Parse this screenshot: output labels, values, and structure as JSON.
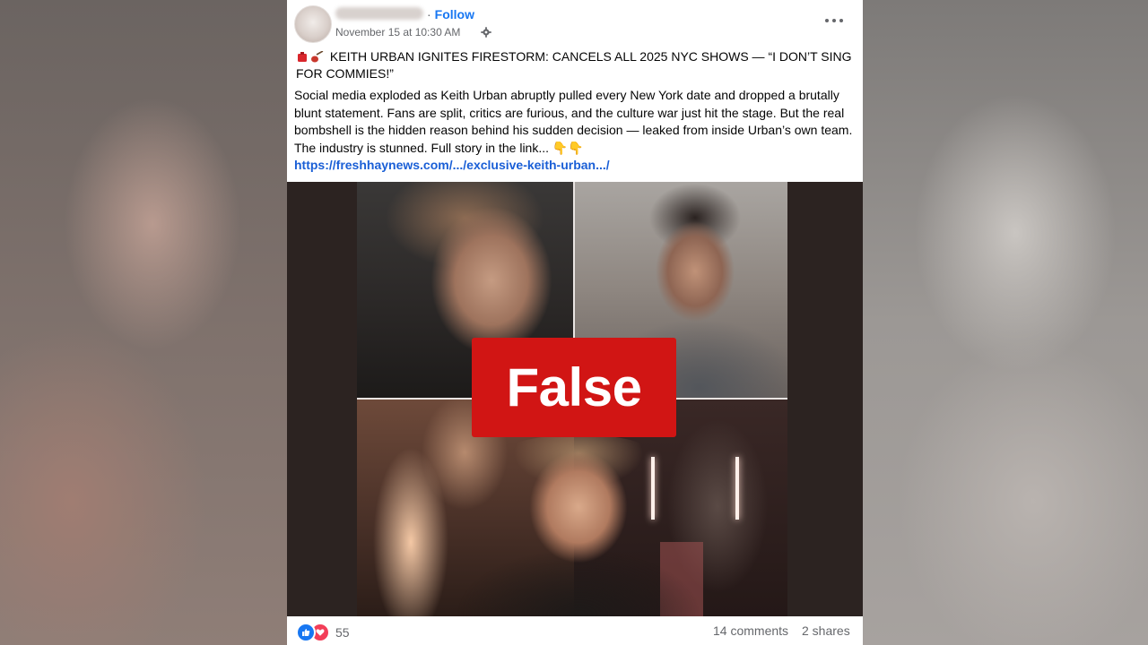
{
  "post": {
    "author_follow": "Follow",
    "date": "November 15 at 10:30 AM",
    "headline": "KEITH URBAN IGNITES FIRESTORM: CANCELS ALL 2025 NYC SHOWS — “I DON’T SING FOR COMMIES!”",
    "body": "Social media exploded as Keith Urban abruptly pulled every New York date and dropped a brutally blunt statement. Fans are split, critics are furious, and the culture war just hit the stage. But the real bombshell is the hidden reason behind his sudden decision — leaked from inside Urban’s own team. The industry is stunned. Full story in the link... 👇👇",
    "link": "https://freshhaynews.com/.../exclusive-keith-urban.../",
    "rating_label": "False",
    "reaction_count": "55",
    "comments": "14 comments",
    "shares": "2 shares"
  },
  "icons": {
    "privacy": "gear-icon",
    "more": "more-options-icon",
    "reactions": [
      "like-icon",
      "love-icon"
    ],
    "headline_emoji": [
      "red-pin-icon",
      "guitar-icon"
    ]
  },
  "colors": {
    "link": "#1a5fd6",
    "follow": "#1877f2",
    "false_badge": "#d11514",
    "like": "#1877f2",
    "love": "#f33e58"
  }
}
